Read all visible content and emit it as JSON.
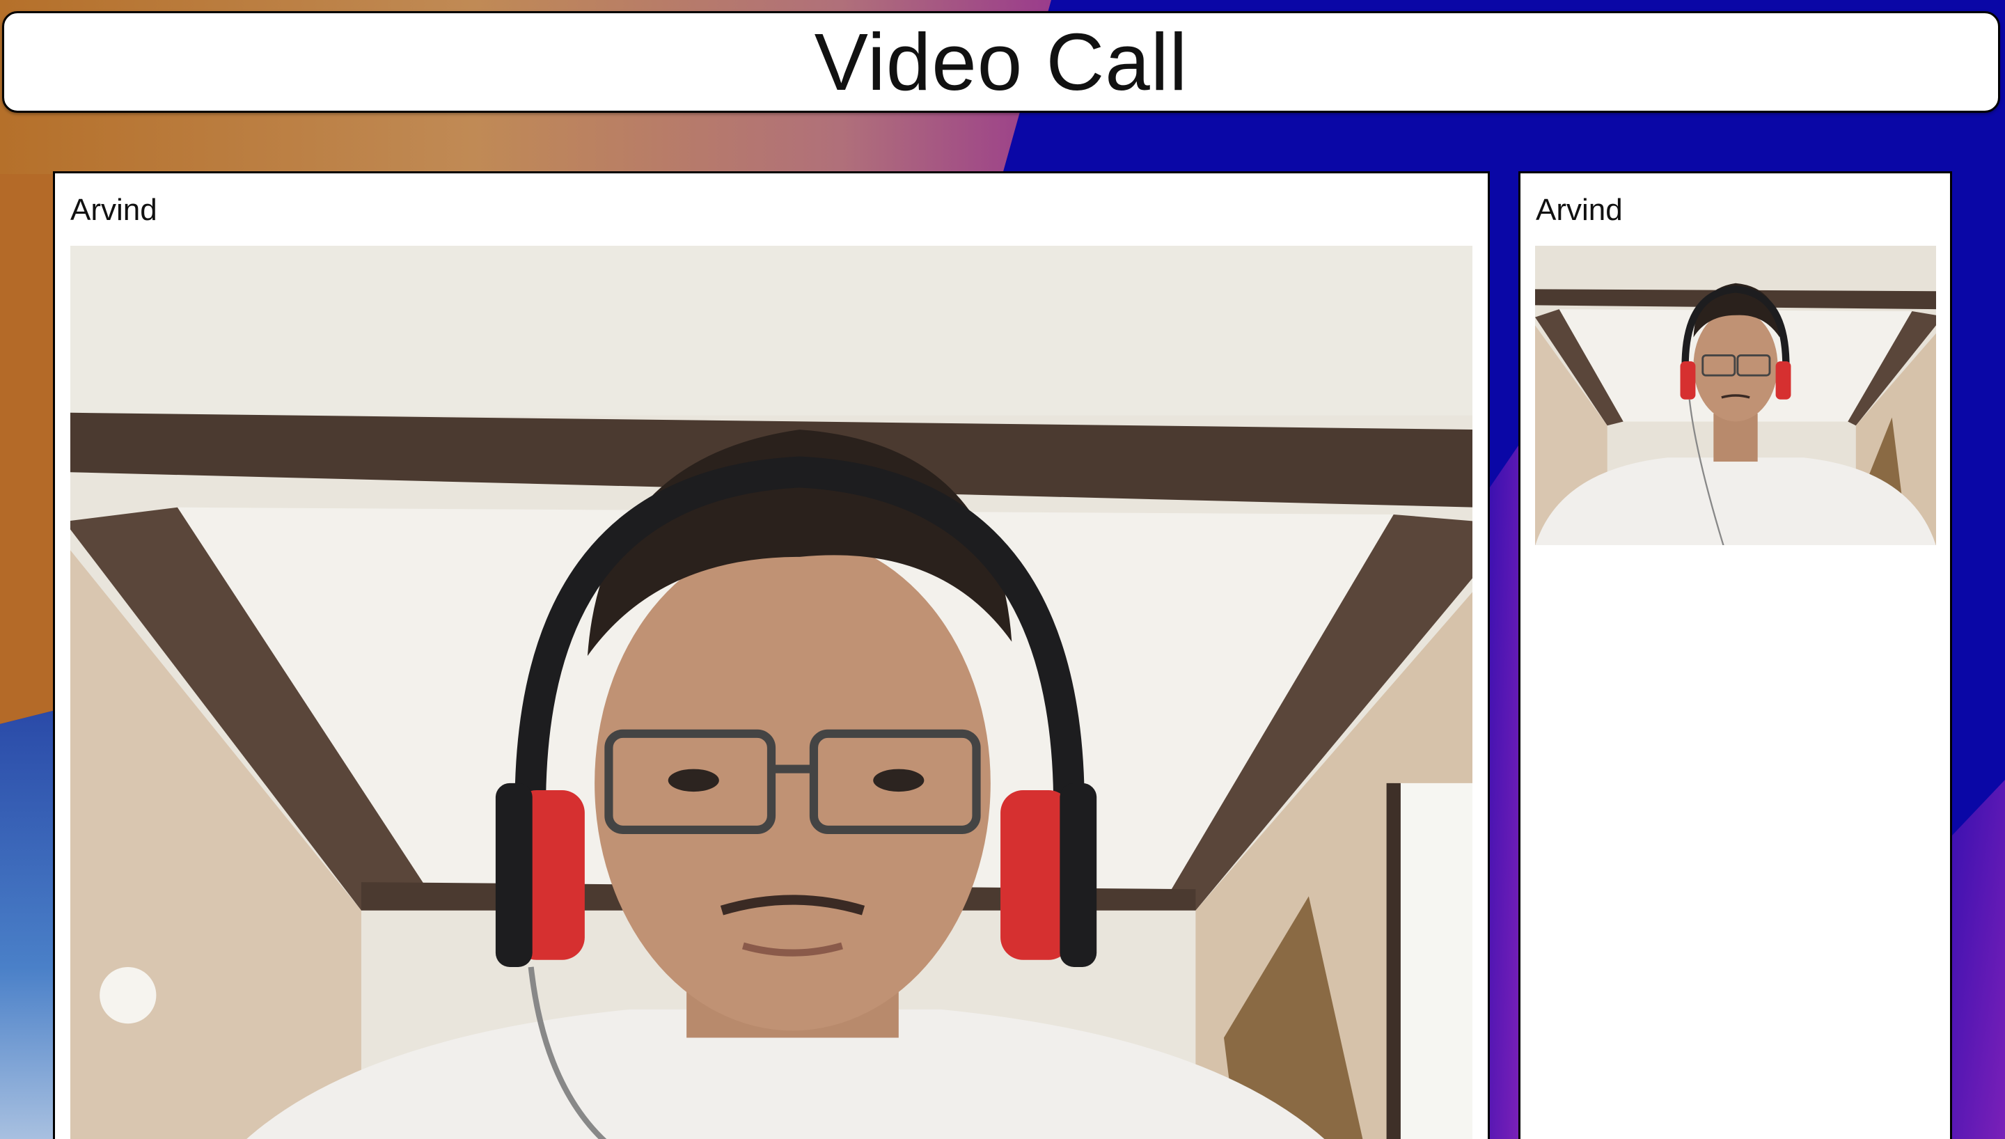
{
  "header": {
    "title": "Video Call"
  },
  "main_video": {
    "participant_name": "Arvind"
  },
  "self_view": {
    "participant_name": "Arvind"
  },
  "colors": {
    "background_blue": "#0a07a6",
    "background_orange": "#c07a2c",
    "background_purple": "#6a1ab0",
    "panel_bg": "#ffffff",
    "border": "#000000",
    "headphone_red": "#d63030"
  }
}
